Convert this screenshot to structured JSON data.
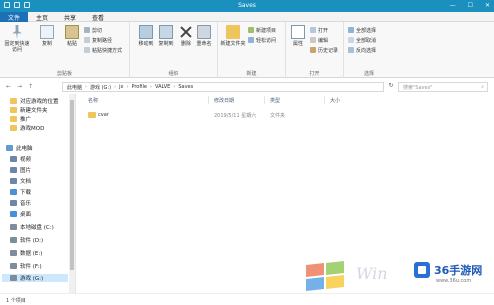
{
  "window": {
    "title": "Saves",
    "minimize": "—",
    "maximize": "☐",
    "close": "✕"
  },
  "tabs": [
    "文件",
    "主页",
    "共享",
    "查看"
  ],
  "ribbon": {
    "clipboard": {
      "label": "剪贴板",
      "pin": "固定到快速访问",
      "copy": "复制",
      "paste": "粘贴",
      "cut": "剪切",
      "copy_path": "复制路径",
      "paste_shortcut": "粘贴快捷方式"
    },
    "organize": {
      "label": "组织",
      "move_to": "移动到",
      "copy_to": "复制到",
      "delete": "删除",
      "rename": "重命名"
    },
    "new": {
      "label": "新建",
      "new_folder": "新建文件夹",
      "new_item": "新建项目",
      "easy_access": "轻松访问"
    },
    "open": {
      "label": "打开",
      "properties": "属性",
      "open": "打开",
      "edit": "编辑",
      "history": "历史记录"
    },
    "select": {
      "label": "选择",
      "select_all": "全部选择",
      "select_none": "全部取消",
      "invert": "反向选择"
    }
  },
  "address": {
    "back": "←",
    "forward": "→",
    "up": "↑",
    "segments": [
      "此电脑",
      "游戏 (G:)",
      "jx",
      "Profile",
      "VALVE",
      "Saves"
    ],
    "refresh": "↻",
    "search_placeholder": "搜索\"Saves\""
  },
  "nav": {
    "items": [
      {
        "label": "对应游戏的位置",
        "color": "#f1c55e"
      },
      {
        "label": "新建文件夹",
        "color": "#f1c55e"
      },
      {
        "label": "推广",
        "color": "#f1c55e"
      },
      {
        "label": "游戏MOD",
        "color": "#f1c55e"
      },
      {
        "label": "此电脑",
        "color": "#5f9bd6"
      },
      {
        "label": "视频",
        "color": "#6b86a8"
      },
      {
        "label": "图片",
        "color": "#6b86a8"
      },
      {
        "label": "文档",
        "color": "#6b86a8"
      },
      {
        "label": "下载",
        "color": "#4a90d9"
      },
      {
        "label": "音乐",
        "color": "#6b86a8"
      },
      {
        "label": "桌面",
        "color": "#4a90d9"
      },
      {
        "label": "本地磁盘 (C:)",
        "color": "#7f8c99"
      },
      {
        "label": "软件 (D:)",
        "color": "#7f8c99"
      },
      {
        "label": "数据 (E:)",
        "color": "#7f8c99"
      },
      {
        "label": "软件 (F:)",
        "color": "#7f8c99"
      },
      {
        "label": "游戏 (G:)",
        "color": "#7f8c99"
      }
    ]
  },
  "columns": {
    "name": "名称",
    "modified": "修改日期",
    "type": "类型",
    "size": "大小"
  },
  "files": [
    {
      "name": "cvar",
      "modified": "2019/5/11 星期六",
      "type": "文件夹",
      "size": ""
    }
  ],
  "status": {
    "count": "1 个项目"
  },
  "watermark": {
    "win_text": "Win",
    "site_name": "36手游网",
    "site_url": "www.36u.com"
  }
}
